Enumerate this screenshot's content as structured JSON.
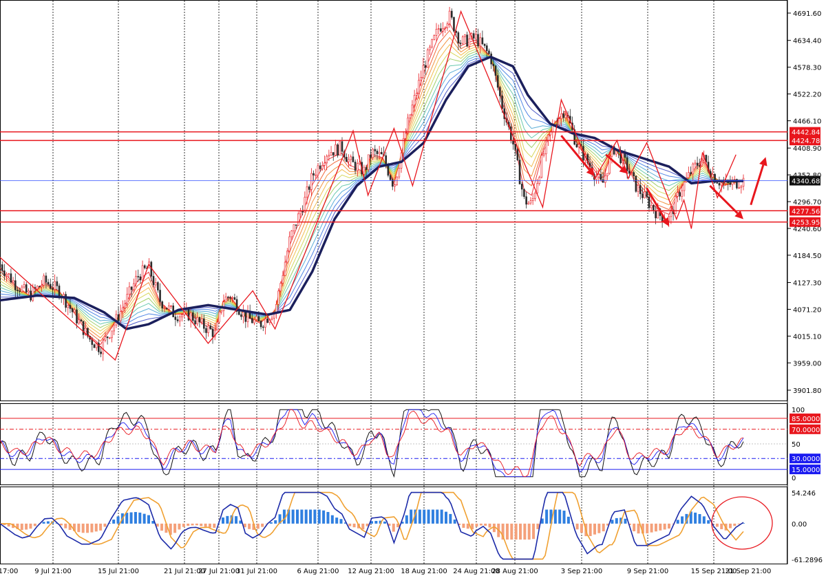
{
  "chart_data": [
    {
      "type": "candlestick",
      "panel": "price",
      "ylim": [
        3880,
        4720
      ],
      "price_ticks": [
        "4691.60",
        "4634.40",
        "4578.30",
        "4522.20",
        "4466.10",
        "4408.90",
        "4352.80",
        "4296.70",
        "4240.60",
        "4184.50",
        "4127.30",
        "4071.20",
        "4015.10",
        "3959.00",
        "3901.80"
      ],
      "tick_values": [
        4691.6,
        4634.4,
        4578.3,
        4522.2,
        4466.1,
        4408.9,
        4352.8,
        4296.7,
        4240.6,
        4184.5,
        4127.3,
        4071.2,
        4015.1,
        3959.0,
        3901.8
      ],
      "time_labels": [
        "17:00",
        "9 Jul 21:00",
        "15 Jul 21:00",
        "21 Jul 21:00",
        "27 Jul 21:00",
        "31 Jul 21:00",
        "6 Aug 21:00",
        "12 Aug 21:00",
        "18 Aug 21:00",
        "24 Aug 21:00",
        "28 Aug 21:00",
        "3 Sep 21:00",
        "9 Sep 21:00",
        "15 Sep 21:00",
        "21 Sep 21:00"
      ],
      "current_price": {
        "label": "4340.68",
        "value": 4340.68
      },
      "horizontal_levels": [
        {
          "label": "4442.84",
          "value": 4442.84
        },
        {
          "label": "4424.78",
          "value": 4424.78
        },
        {
          "label": "4277.56",
          "value": 4277.56
        },
        {
          "label": "4253.95",
          "value": 4253.95
        }
      ],
      "close_path": [
        [
          0,
          4165
        ],
        [
          0.02,
          4125
        ],
        [
          0.04,
          4100
        ],
        [
          0.06,
          4130
        ],
        [
          0.08,
          4110
        ],
        [
          0.1,
          4060
        ],
        [
          0.12,
          4010
        ],
        [
          0.135,
          3990
        ],
        [
          0.15,
          4030
        ],
        [
          0.165,
          4075
        ],
        [
          0.185,
          4140
        ],
        [
          0.2,
          4160
        ],
        [
          0.215,
          4090
        ],
        [
          0.235,
          4060
        ],
        [
          0.255,
          4060
        ],
        [
          0.27,
          4040
        ],
        [
          0.29,
          4020
        ],
        [
          0.3,
          4090
        ],
        [
          0.31,
          4100
        ],
        [
          0.33,
          4055
        ],
        [
          0.35,
          4040
        ],
        [
          0.37,
          4070
        ],
        [
          0.39,
          4220
        ],
        [
          0.41,
          4300
        ],
        [
          0.42,
          4350
        ],
        [
          0.44,
          4400
        ],
        [
          0.46,
          4410
        ],
        [
          0.47,
          4380
        ],
        [
          0.49,
          4360
        ],
        [
          0.5,
          4400
        ],
        [
          0.515,
          4390
        ],
        [
          0.53,
          4330
        ],
        [
          0.55,
          4470
        ],
        [
          0.57,
          4580
        ],
        [
          0.59,
          4660
        ],
        [
          0.605,
          4685
        ],
        [
          0.62,
          4630
        ],
        [
          0.64,
          4640
        ],
        [
          0.66,
          4600
        ],
        [
          0.675,
          4500
        ],
        [
          0.69,
          4420
        ],
        [
          0.705,
          4300
        ],
        [
          0.715,
          4290
        ],
        [
          0.73,
          4390
        ],
        [
          0.745,
          4460
        ],
        [
          0.76,
          4490
        ],
        [
          0.775,
          4420
        ],
        [
          0.79,
          4380
        ],
        [
          0.81,
          4330
        ],
        [
          0.825,
          4410
        ],
        [
          0.84,
          4380
        ],
        [
          0.855,
          4330
        ],
        [
          0.87,
          4300
        ],
        [
          0.885,
          4270
        ],
        [
          0.9,
          4260
        ],
        [
          0.915,
          4320
        ],
        [
          0.93,
          4360
        ],
        [
          0.945,
          4390
        ],
        [
          0.96,
          4350
        ],
        [
          0.975,
          4330
        ],
        [
          1.0,
          4341
        ]
      ],
      "ma_path": [
        [
          0,
          4090
        ],
        [
          0.05,
          4100
        ],
        [
          0.1,
          4095
        ],
        [
          0.14,
          4065
        ],
        [
          0.17,
          4030
        ],
        [
          0.2,
          4040
        ],
        [
          0.24,
          4070
        ],
        [
          0.28,
          4080
        ],
        [
          0.32,
          4070
        ],
        [
          0.36,
          4060
        ],
        [
          0.39,
          4070
        ],
        [
          0.42,
          4150
        ],
        [
          0.45,
          4260
        ],
        [
          0.48,
          4330
        ],
        [
          0.51,
          4370
        ],
        [
          0.54,
          4380
        ],
        [
          0.57,
          4420
        ],
        [
          0.6,
          4510
        ],
        [
          0.63,
          4580
        ],
        [
          0.66,
          4600
        ],
        [
          0.69,
          4580
        ],
        [
          0.71,
          4520
        ],
        [
          0.74,
          4460
        ],
        [
          0.77,
          4440
        ],
        [
          0.8,
          4430
        ],
        [
          0.83,
          4405
        ],
        [
          0.86,
          4390
        ],
        [
          0.9,
          4370
        ],
        [
          0.93,
          4335
        ],
        [
          0.96,
          4340
        ],
        [
          1.0,
          4340
        ]
      ],
      "zigzag": [
        [
          0,
          4180
        ],
        [
          0.155,
          3965
        ],
        [
          0.2,
          4165
        ],
        [
          0.28,
          4000
        ],
        [
          0.34,
          4110
        ],
        [
          0.37,
          4030
        ],
        [
          0.475,
          4445
        ],
        [
          0.495,
          4310
        ],
        [
          0.53,
          4450
        ],
        [
          0.555,
          4330
        ],
        [
          0.62,
          4695
        ],
        [
          0.73,
          4285
        ],
        [
          0.755,
          4510
        ],
        [
          0.8,
          4345
        ],
        [
          0.83,
          4425
        ],
        [
          0.845,
          4345
        ],
        [
          0.87,
          4420
        ],
        [
          0.91,
          4260
        ],
        [
          0.92,
          4300
        ],
        [
          0.93,
          4240
        ],
        [
          0.945,
          4400
        ],
        [
          0.965,
          4305
        ],
        [
          0.99,
          4395
        ]
      ],
      "arrows": [
        {
          "from": [
            0.755,
            4435
          ],
          "to": [
            0.8,
            4350
          ]
        },
        {
          "from": [
            0.815,
            4395
          ],
          "to": [
            0.845,
            4355
          ]
        },
        {
          "from": [
            0.87,
            4325
          ],
          "to": [
            0.9,
            4245
          ]
        },
        {
          "from": [
            0.955,
            4330
          ],
          "to": [
            1.0,
            4260
          ]
        },
        {
          "from": [
            1.01,
            4290
          ],
          "to": [
            1.03,
            4390
          ]
        }
      ]
    },
    {
      "type": "line",
      "panel": "oscillator",
      "ylim": [
        0,
        100
      ],
      "levels": [
        {
          "label": "85.0000",
          "value": 85,
          "color": "#e8161d"
        },
        {
          "label": "70.0000",
          "value": 70,
          "color": "#e8161d"
        },
        {
          "label": "30.0000",
          "value": 30,
          "color": "#1a1af0"
        },
        {
          "label": "15.0000",
          "value": 15,
          "color": "#1a1af0"
        }
      ],
      "axis_ticks": [
        {
          "label": "100",
          "value": 100
        },
        {
          "label": "50",
          "value": 50
        },
        {
          "label": "0",
          "value": 0
        }
      ]
    },
    {
      "type": "line",
      "panel": "macd",
      "ylim": [
        -61.2896,
        54.246
      ],
      "axis_ticks": [
        {
          "label": "54.246",
          "value": 54.246
        },
        {
          "label": "0.00",
          "value": 0
        },
        {
          "label": "-61.2896",
          "value": -61.2896
        }
      ]
    }
  ],
  "colors": {
    "bull": "#e8161d",
    "bear": "#2a2a2a",
    "ma": "#1b1f5c",
    "level": "#e8161d",
    "current": "#3050ff",
    "hist_pos": "#2f7fe0",
    "hist_neg": "#f4a07a",
    "fast": "#1b2aa8",
    "slow": "#f0a030",
    "circle": "#e8161d"
  }
}
